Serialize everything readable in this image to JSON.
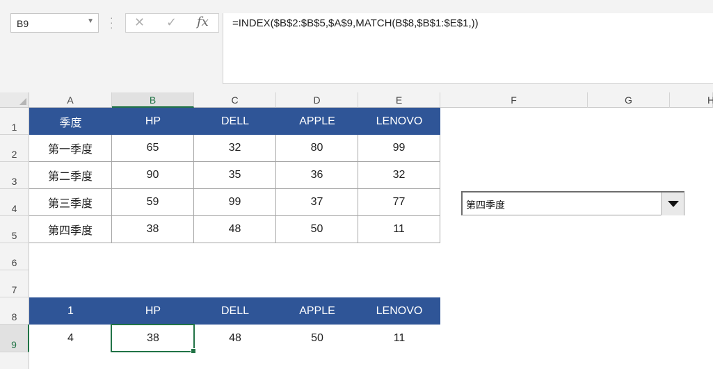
{
  "formula_bar": {
    "name_box": "B9",
    "formula": "=INDEX($B$2:$B$5,$A$9,MATCH(B$8,$B$1:$E$1,))",
    "cancel_icon": "✕",
    "enter_icon": "✓",
    "fx_label": "fx"
  },
  "columns": [
    "A",
    "B",
    "C",
    "D",
    "E",
    "F",
    "G",
    "H"
  ],
  "rows": [
    "1",
    "2",
    "3",
    "4",
    "5",
    "6",
    "7",
    "8",
    "9"
  ],
  "table1": {
    "header": [
      "季度",
      "HP",
      "DELL",
      "APPLE",
      "LENOVO"
    ],
    "rows": [
      [
        "第一季度",
        "65",
        "32",
        "80",
        "99"
      ],
      [
        "第二季度",
        "90",
        "35",
        "36",
        "32"
      ],
      [
        "第三季度",
        "59",
        "99",
        "37",
        "77"
      ],
      [
        "第四季度",
        "38",
        "48",
        "50",
        "11"
      ]
    ]
  },
  "table2": {
    "header": [
      "1",
      "HP",
      "DELL",
      "APPLE",
      "LENOVO"
    ],
    "row": [
      "4",
      "38",
      "48",
      "50",
      "11"
    ]
  },
  "dropdown": {
    "selected": "第四季度"
  },
  "colors": {
    "header_fill": "#2f5597",
    "selection": "#217346"
  }
}
